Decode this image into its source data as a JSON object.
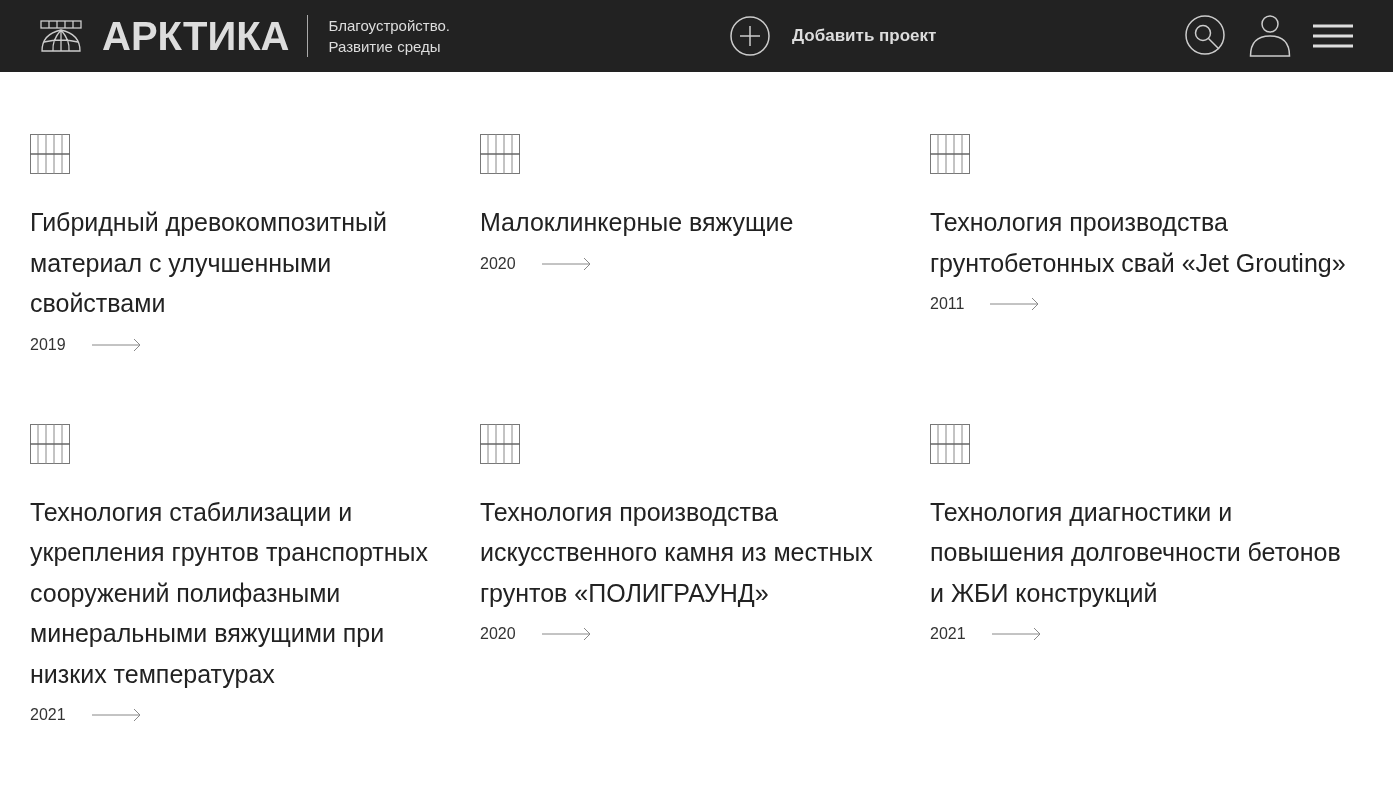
{
  "header": {
    "logo": "АРКТИКА",
    "tagline_1": "Благоустройство.",
    "tagline_2": "Развитие среды",
    "add_project": "Добавить проект"
  },
  "projects": [
    {
      "title": "Гибридный древокомпозитный материал с улучшенными свойствами",
      "year": "2019"
    },
    {
      "title": "Малоклинкерные вяжущие",
      "year": "2020"
    },
    {
      "title": "Технология производства грунтобетонных свай «Jet Grouting»",
      "year": "2011"
    },
    {
      "title": "Технология стабилизации и укрепления грунтов транспортных сооружений полифазными минеральными вяжущими при низких температурах",
      "year": "2021"
    },
    {
      "title": "Технология производства искусственного камня из местных грунтов «ПОЛИГРАУНД»",
      "year": "2020"
    },
    {
      "title": "Технология диагностики и повышения долговечности бетонов и ЖБИ конструкций",
      "year": "2021"
    }
  ]
}
